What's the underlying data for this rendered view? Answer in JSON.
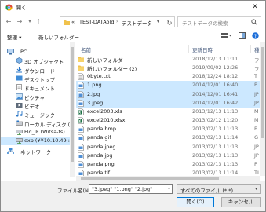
{
  "window": {
    "title": "開く"
  },
  "address": {
    "crumbs": [
      "«",
      "TEST-DATAold",
      "テストデータ"
    ],
    "search_placeholder": "テストデータの検索"
  },
  "toolbar": {
    "organize_label": "整理 ▾",
    "new_folder_label": "新しいフォルダー"
  },
  "sidebar": {
    "items": [
      {
        "label": "PC",
        "icon": "pc-icon"
      },
      {
        "label": "3D オブジェクト",
        "icon": "cube-icon"
      },
      {
        "label": "ダウンロード",
        "icon": "download-icon"
      },
      {
        "label": "デスクトップ",
        "icon": "desktop-icon"
      },
      {
        "label": "ドキュメント",
        "icon": "document-icon"
      },
      {
        "label": "ピクチャ",
        "icon": "picture-icon"
      },
      {
        "label": "ビデオ",
        "icon": "video-icon"
      },
      {
        "label": "ミュージック",
        "icon": "music-icon"
      },
      {
        "label": "ローカル ディスク (C",
        "icon": "disk-icon"
      },
      {
        "label": "Fld_IF (Witsa-fs)",
        "icon": "network-drive-icon"
      },
      {
        "label": "exp (¥¥10.10.49.:",
        "icon": "network-drive-icon"
      },
      {
        "label": "ネットワーク",
        "icon": "network-icon"
      }
    ]
  },
  "list": {
    "headers": {
      "name": "名前",
      "date": "更新日時",
      "kind": "種"
    },
    "rows": [
      {
        "name": "新しいフォルダー",
        "date": "2018/12/13 11:11",
        "kind": "フ",
        "icon": "folder-icon",
        "selected": false
      },
      {
        "name": "新しいフォルダー (2)",
        "date": "2019/09/02 12:26",
        "kind": "フ",
        "icon": "folder-icon",
        "selected": false
      },
      {
        "name": "0byte.txt",
        "date": "2018/12/24 18:12",
        "kind": "T",
        "icon": "text-file-icon",
        "selected": false
      },
      {
        "name": "1.png",
        "date": "2014/12/01 16:40",
        "kind": "P",
        "icon": "image-file-icon",
        "selected": true
      },
      {
        "name": "2.jpg",
        "date": "2014/12/01 16:41",
        "kind": "JP",
        "icon": "image-file-icon",
        "selected": true
      },
      {
        "name": "3.jpeg",
        "date": "2014/12/01 16:42",
        "kind": "JP",
        "icon": "image-file-icon",
        "selected": true
      },
      {
        "name": "excel2003.xls",
        "date": "2013/12/13 11:13",
        "kind": "M",
        "icon": "excel-file-icon",
        "selected": false
      },
      {
        "name": "excel2010.xlsx",
        "date": "2013/02/12 11:20",
        "kind": "M",
        "icon": "excel-file-icon",
        "selected": false
      },
      {
        "name": "panda.bmp",
        "date": "2013/02/13 11:13",
        "kind": "B",
        "icon": "image-file-icon",
        "selected": false
      },
      {
        "name": "panda.gif",
        "date": "2013/02/13 11:14",
        "kind": "G",
        "icon": "image-file-icon",
        "selected": false
      },
      {
        "name": "panda.jpeg",
        "date": "2013/02/13 11:13",
        "kind": "JP",
        "icon": "image-file-icon",
        "selected": false
      },
      {
        "name": "panda.jpg",
        "date": "2013/02/13 11:13",
        "kind": "JP",
        "icon": "image-file-icon",
        "selected": false
      },
      {
        "name": "panda.png",
        "date": "2013/02/13 11:13",
        "kind": "P",
        "icon": "image-file-icon",
        "selected": false
      },
      {
        "name": "panda.tif",
        "date": "2013/02/13 11:14",
        "kind": "TI",
        "icon": "image-file-icon",
        "selected": false
      }
    ]
  },
  "footer": {
    "filename_label": "ファイル名(N):",
    "filename_value": "\"3.jpeg\" \"1.png\" \"2.jpg\"",
    "filetype_value": "すべてのファイル (*.*)",
    "open_label": "開く(O)",
    "cancel_label": "キャンセル"
  },
  "colors": {
    "selection": "#cce8ff",
    "folder": "#f0c24d",
    "accent": "#0078d7"
  }
}
